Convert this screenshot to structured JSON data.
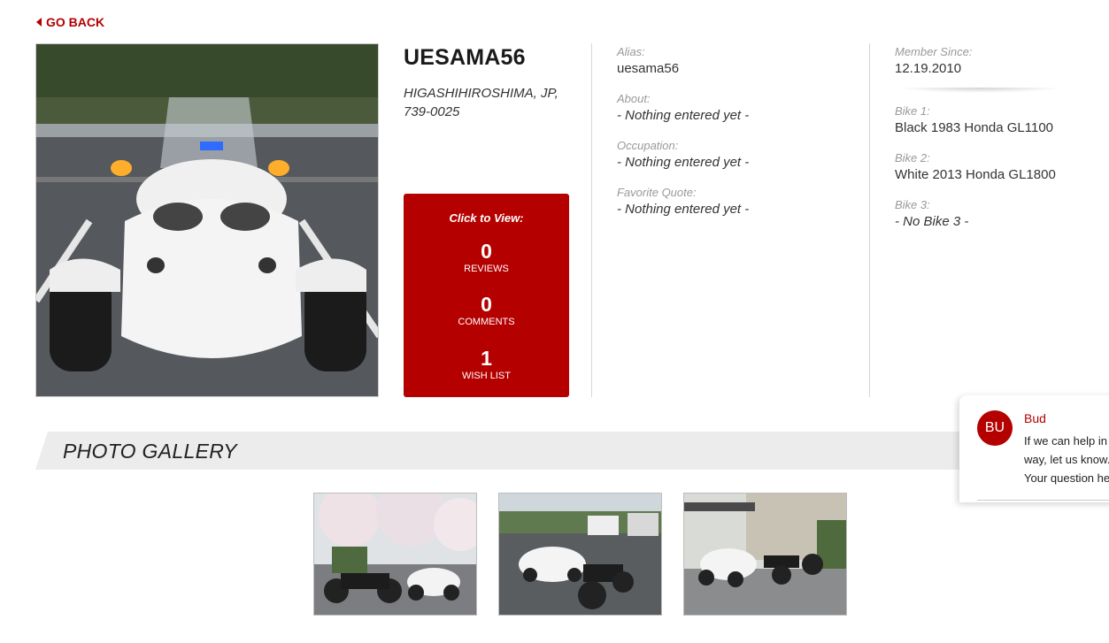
{
  "nav": {
    "go_back": "GO BACK"
  },
  "profile": {
    "username": "UESAMA56",
    "location": "HIGASHIHIROSHIMA, JP, 739-0025"
  },
  "stats": {
    "title": "Click to View:",
    "reviews": {
      "count": "0",
      "label": "REVIEWS"
    },
    "comments": {
      "count": "0",
      "label": "COMMENTS"
    },
    "wishlist": {
      "count": "1",
      "label": "WISH LIST"
    }
  },
  "details": {
    "alias": {
      "label": "Alias:",
      "value": "uesama56"
    },
    "about": {
      "label": "About:",
      "value": "- Nothing entered yet -"
    },
    "occupation": {
      "label": "Occupation:",
      "value": "- Nothing entered yet -"
    },
    "quote": {
      "label": "Favorite Quote:",
      "value": "- Nothing entered yet -"
    }
  },
  "member": {
    "since": {
      "label": "Member Since:",
      "value": "12.19.2010"
    },
    "bike1": {
      "label": "Bike 1:",
      "value": "Black 1983 Honda GL1100"
    },
    "bike2": {
      "label": "Bike 2:",
      "value": "White 2013 Honda GL1800"
    },
    "bike3": {
      "label": "Bike 3:",
      "value": "- No Bike 3 -"
    }
  },
  "gallery": {
    "title": "PHOTO GALLERY"
  },
  "chat": {
    "avatar": "BU",
    "name": "Bud",
    "message": "If we can help in any way, let us know. Your question here."
  },
  "colors": {
    "brand_red": "#b50000",
    "link_red": "#b30000",
    "label_gray": "#999999"
  }
}
